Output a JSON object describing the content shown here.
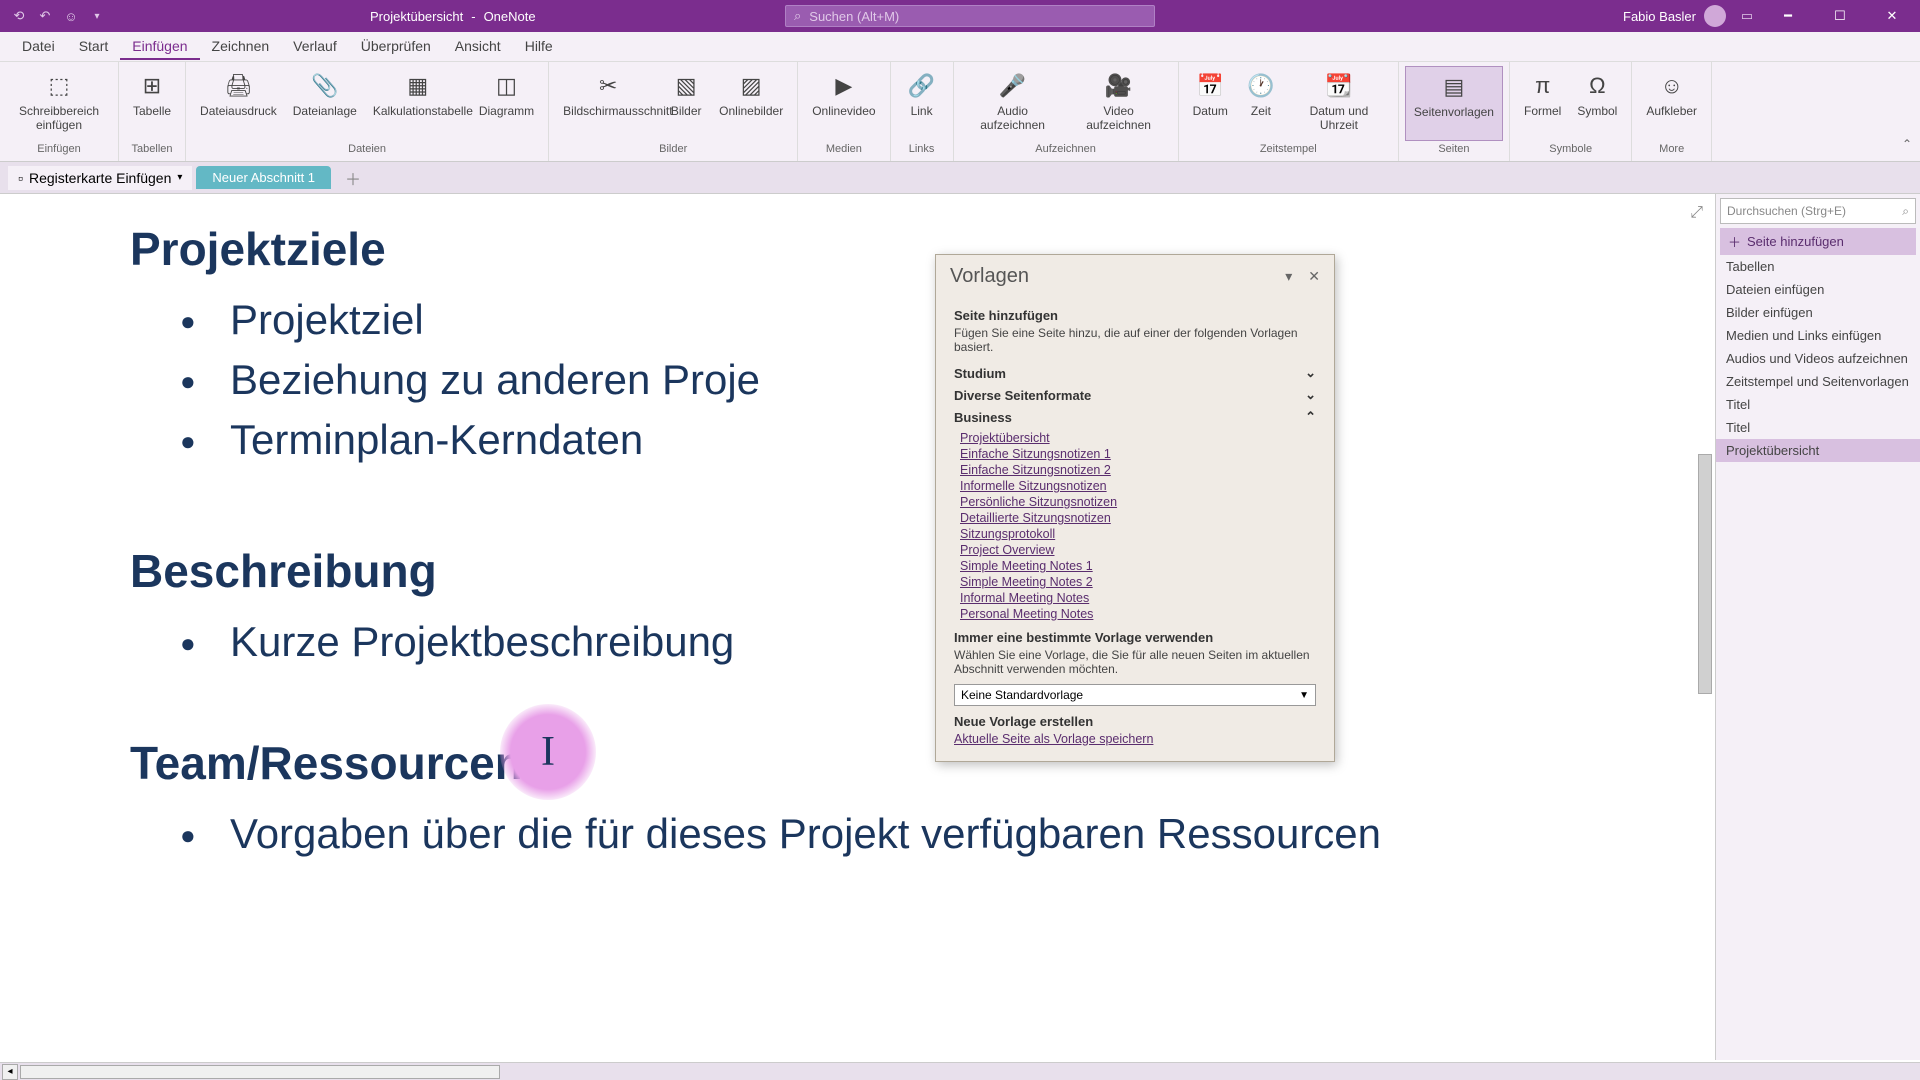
{
  "titlebar": {
    "doc": "Projektübersicht",
    "app": "OneNote",
    "search_placeholder": "Suchen (Alt+M)",
    "user": "Fabio Basler"
  },
  "menus": [
    "Datei",
    "Start",
    "Einfügen",
    "Zeichnen",
    "Verlauf",
    "Überprüfen",
    "Ansicht",
    "Hilfe"
  ],
  "active_menu": 2,
  "ribbon": {
    "groups": [
      {
        "label": "Einfügen",
        "items": [
          {
            "k": "space",
            "t": "Schreibbereich einfügen"
          }
        ]
      },
      {
        "label": "Tabellen",
        "items": [
          {
            "k": "table",
            "t": "Tabelle"
          }
        ]
      },
      {
        "label": "Dateien",
        "items": [
          {
            "k": "print",
            "t": "Dateiausdruck"
          },
          {
            "k": "attach",
            "t": "Dateianlage"
          },
          {
            "k": "xls",
            "t": "Kalkulationstabelle"
          },
          {
            "k": "diag",
            "t": "Diagramm"
          }
        ]
      },
      {
        "label": "Bilder",
        "items": [
          {
            "k": "clip",
            "t": "Bildschirmausschnitt"
          },
          {
            "k": "img",
            "t": "Bilder"
          },
          {
            "k": "oimg",
            "t": "Onlinebilder"
          }
        ]
      },
      {
        "label": "Medien",
        "items": [
          {
            "k": "vid",
            "t": "Onlinevideo"
          }
        ]
      },
      {
        "label": "Links",
        "items": [
          {
            "k": "link",
            "t": "Link"
          }
        ]
      },
      {
        "label": "Aufzeichnen",
        "items": [
          {
            "k": "aud",
            "t": "Audio aufzeichnen"
          },
          {
            "k": "vrec",
            "t": "Video aufzeichnen"
          }
        ]
      },
      {
        "label": "Zeitstempel",
        "items": [
          {
            "k": "date",
            "t": "Datum"
          },
          {
            "k": "time",
            "t": "Zeit"
          },
          {
            "k": "dt",
            "t": "Datum und Uhrzeit"
          }
        ]
      },
      {
        "label": "Seiten",
        "items": [
          {
            "k": "tmpl",
            "t": "Seitenvorlagen",
            "active": true
          }
        ]
      },
      {
        "label": "Symbole",
        "items": [
          {
            "k": "form",
            "t": "Formel"
          },
          {
            "k": "sym",
            "t": "Symbol"
          }
        ]
      },
      {
        "label": "More",
        "items": [
          {
            "k": "stk",
            "t": "Aufkleber"
          }
        ]
      }
    ]
  },
  "tabs": {
    "dropdown": "Registerkarte Einfügen",
    "section": "Neuer Abschnitt 1"
  },
  "page": {
    "h1a": "Projektziele",
    "b1": "Projektziel",
    "b2": "Beziehung zu anderen Proje",
    "b3": "Terminplan-Kerndaten",
    "h1b": "Beschreibung",
    "b4": "Kurze Projektbeschreibung",
    "h1c": "Team/Ressourcen",
    "b5": "Vorgaben über die für dieses Projekt verfügbaren Ressourcen"
  },
  "templates": {
    "title": "Vorlagen",
    "add_title": "Seite hinzufügen",
    "add_desc": "Fügen Sie eine Seite hinzu, die auf einer der folgenden Vorlagen basiert.",
    "cat1": "Studium",
    "cat2": "Diverse Seitenformate",
    "cat3": "Business",
    "links": [
      "Projektübersicht",
      "Einfache Sitzungsnotizen 1",
      "Einfache Sitzungsnotizen 2",
      "Informelle Sitzungsnotizen",
      "Persönliche Sitzungsnotizen",
      "Detaillierte Sitzungsnotizen",
      "Sitzungsprotokoll",
      "Project Overview",
      "Simple Meeting Notes 1",
      "Simple Meeting Notes 2",
      "Informal Meeting Notes",
      "Personal Meeting Notes"
    ],
    "always_title": "Immer eine bestimmte Vorlage verwenden",
    "always_desc": "Wählen Sie eine Vorlage, die Sie für alle neuen Seiten im aktuellen Abschnitt verwenden möchten.",
    "select_val": "Keine Standardvorlage",
    "create_title": "Neue Vorlage erstellen",
    "create_link": "Aktuelle Seite als Vorlage speichern"
  },
  "right": {
    "search_ph": "Durchsuchen (Strg+E)",
    "add": "Seite hinzufügen",
    "items": [
      "Tabellen",
      "Dateien einfügen",
      "Bilder einfügen",
      "Medien und Links einfügen",
      "Audios und Videos aufzeichnen",
      "Zeitstempel und Seitenvorlagen",
      "Titel",
      "Titel",
      "Projektübersicht"
    ],
    "selected": 8
  }
}
